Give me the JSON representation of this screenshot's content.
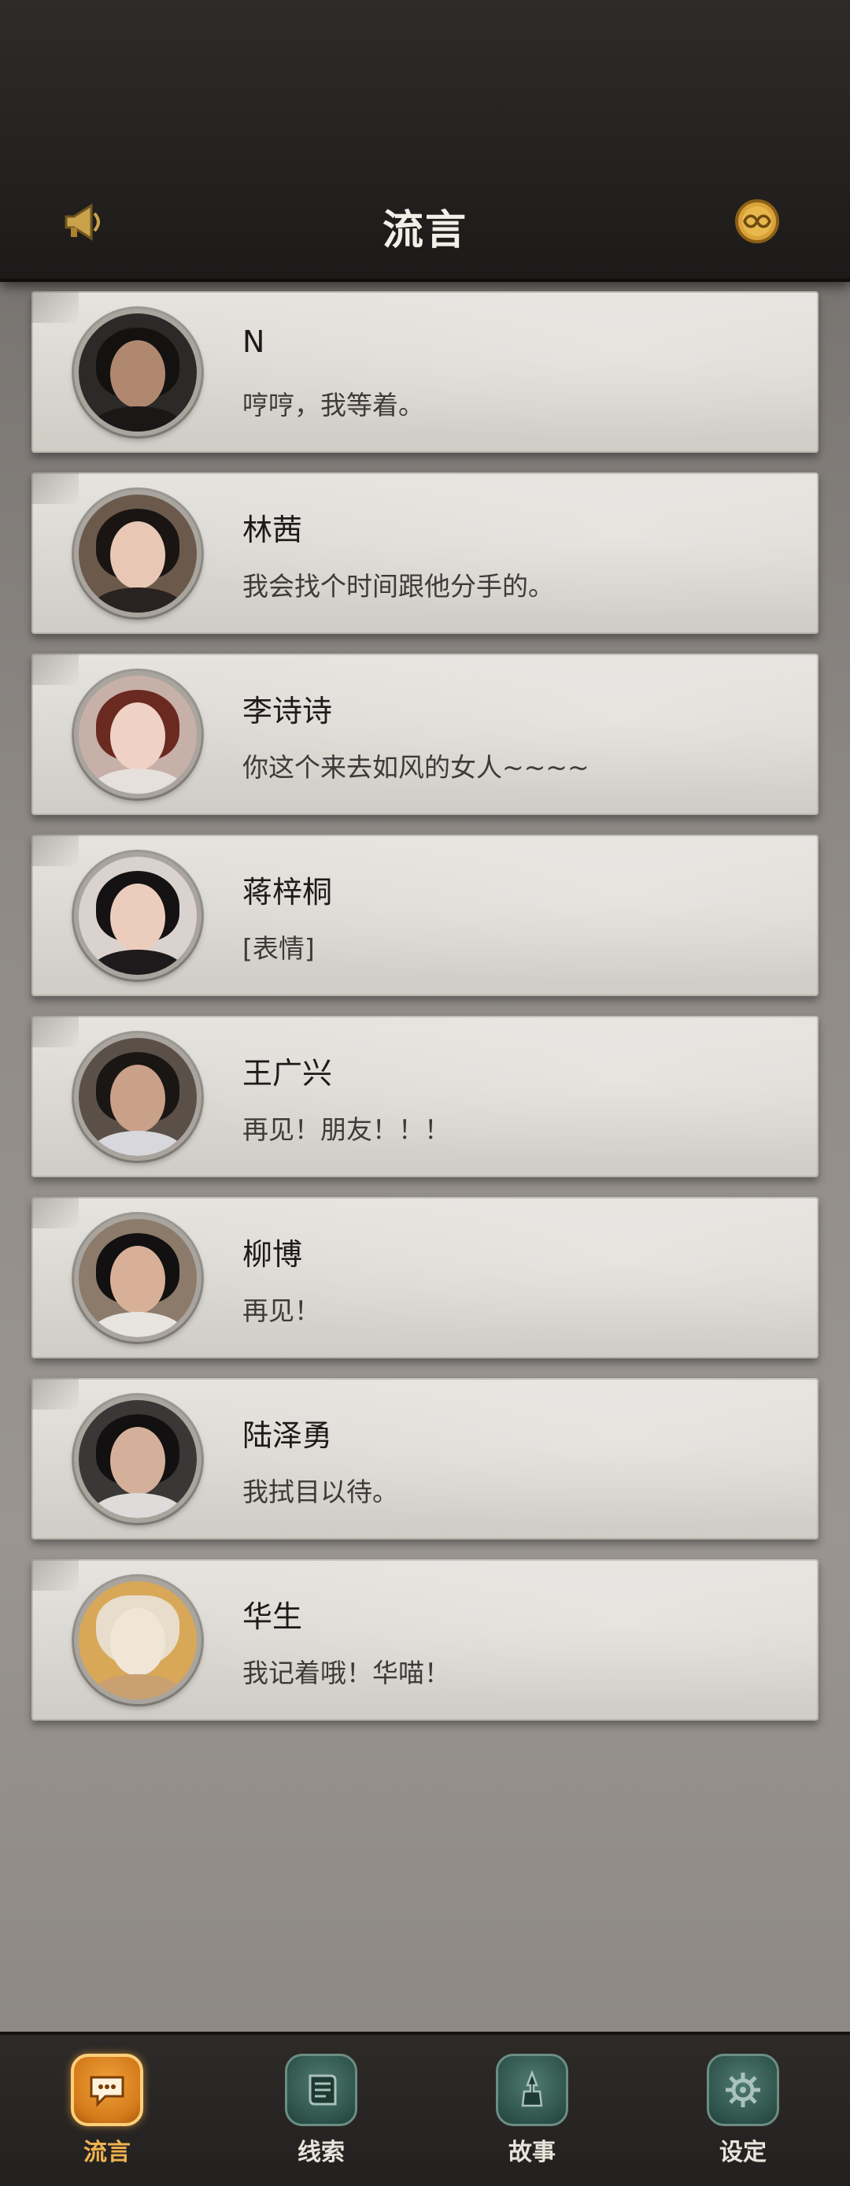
{
  "header": {
    "title": "流言",
    "left_icon": "megaphone-icon",
    "right_icon": "infinity-coin-icon"
  },
  "conversations": [
    {
      "name": "N",
      "message": "哼哼，我等着。"
    },
    {
      "name": "林茜",
      "message": "我会找个时间跟他分手的。"
    },
    {
      "name": "李诗诗",
      "message": "你这个来去如风的女人~~~~"
    },
    {
      "name": "蒋梓桐",
      "message": "[表情]"
    },
    {
      "name": "王广兴",
      "message": "再见！朋友！！！"
    },
    {
      "name": "柳博",
      "message": "再见！"
    },
    {
      "name": "陆泽勇",
      "message": "我拭目以待。"
    },
    {
      "name": "华生",
      "message": "我记着哦！华喵！"
    }
  ],
  "tabs": [
    {
      "label": "流言",
      "icon": "chat-bubble-icon",
      "active": true
    },
    {
      "label": "线索",
      "icon": "scroll-icon",
      "active": false
    },
    {
      "label": "故事",
      "icon": "tower-icon",
      "active": false
    },
    {
      "label": "设定",
      "icon": "gear-icon",
      "active": false
    }
  ],
  "colors": {
    "header_bg": "#242120",
    "card_bg": "#dedbd6",
    "active_tab": "#f0b350",
    "tab_icon_green": "#2f544b"
  }
}
